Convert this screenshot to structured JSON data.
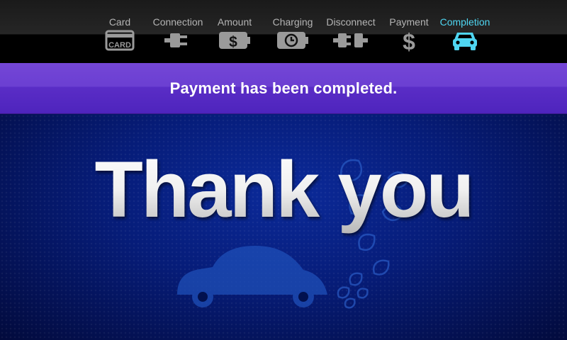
{
  "steps": [
    {
      "label": "Card",
      "icon": "card-icon",
      "icon_text": "CARD"
    },
    {
      "label": "Connection",
      "icon": "plug-icon"
    },
    {
      "label": "Amount",
      "icon": "battery-dollar-icon",
      "icon_text": "$"
    },
    {
      "label": "Charging",
      "icon": "battery-clock-icon"
    },
    {
      "label": "Disconnect",
      "icon": "unplug-icon"
    },
    {
      "label": "Payment",
      "icon": "dollar-icon",
      "icon_text": "$"
    },
    {
      "label": "Completion",
      "icon": "car-icon",
      "active": true
    }
  ],
  "banner": {
    "message": "Payment has been completed."
  },
  "main": {
    "headline": "Thank you"
  },
  "colors": {
    "active_step": "#4fd6f2",
    "inactive_step": "#b4b4b4",
    "banner": "#5a2dc6",
    "background": "#061c78"
  }
}
